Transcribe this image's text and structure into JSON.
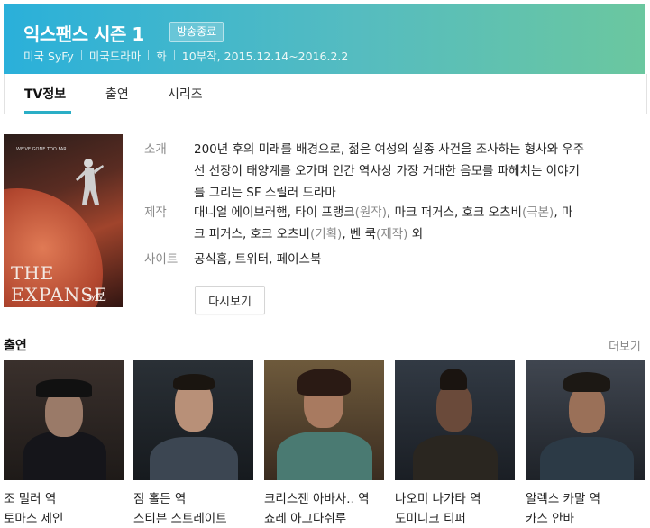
{
  "header": {
    "title": "익스팬스 시즌 1",
    "badge": "방송종료",
    "meta": [
      "미국 SyFy",
      "미국드라마",
      "화",
      "10부작, 2015.12.14~2016.2.2"
    ]
  },
  "tabs": [
    "TV정보",
    "출연",
    "시리즈"
  ],
  "poster": {
    "title": "THE EXPANSE",
    "tagline": "WE'VE GONE TOO FAR",
    "network": "SyFy"
  },
  "info": {
    "synopsis_label": "소개",
    "synopsis_lines": [
      "200년 후의 미래를 배경으로, 젊은 여성의 실종 사건을 조사하는 형사와 우주",
      "선 선장이 태양계를 오가며 인간 역사상 가장 거대한 음모를 파헤치는 이야기",
      "를 그리는 SF 스릴러 드라마"
    ],
    "production_label": "제작",
    "production_line1_a": "대니얼 에이브러햄, 타이 프랭크",
    "production_line1_b": "(원작)",
    "production_line1_c": ", 마크 퍼거스, 호크 오츠비",
    "production_line1_d": "(극본)",
    "production_line1_e": ", 마",
    "production_line2_a": "크 퍼거스, 호크 오츠비",
    "production_line2_b": "(기획)",
    "production_line2_c": ", 벤 쿡",
    "production_line2_d": "(제작)",
    "production_line2_e": " 외",
    "site_label": "사이트",
    "sites": [
      "공식홈",
      "트위터",
      "페이스북"
    ],
    "rewatch_button": "다시보기"
  },
  "cast": {
    "title": "출연",
    "more": "더보기",
    "members": [
      {
        "role": "조 밀러 역",
        "name": "토마스 제인"
      },
      {
        "role": "짐 홀든 역",
        "name": "스티븐 스트레이트"
      },
      {
        "role": "크리스젠 아바사.. 역",
        "name": "쇼레 아그다쉬루"
      },
      {
        "role": "나오미 나가타 역",
        "name": "도미니크 티퍼"
      },
      {
        "role": "알렉스 카말 역",
        "name": "카스 안바"
      }
    ]
  }
}
